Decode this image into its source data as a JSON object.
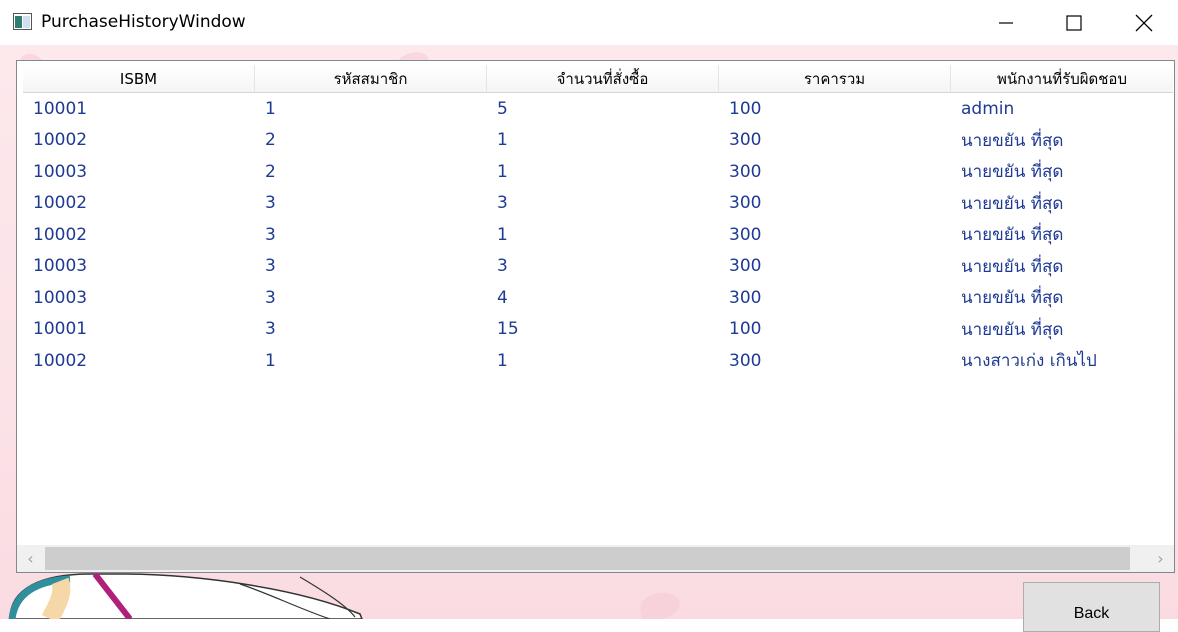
{
  "window": {
    "title": "PurchaseHistoryWindow",
    "app_icon": "window-app-icon"
  },
  "controls": {
    "minimize": "minimize-icon",
    "maximize": "maximize-icon",
    "close": "close-icon"
  },
  "grid": {
    "columns": [
      "ISBM",
      "รหัสสมาชิก",
      "จำนวนที่สั่งซื้อ",
      "ราคารวม",
      "พนักงานที่รับผิดชอบ"
    ],
    "rows": [
      [
        "10001",
        "1",
        "5",
        "100",
        "admin"
      ],
      [
        "10002",
        "2",
        "1",
        "300",
        "นายขยัน ที่สุด"
      ],
      [
        "10003",
        "2",
        "1",
        "300",
        "นายขยัน ที่สุด"
      ],
      [
        "10002",
        "3",
        "3",
        "300",
        "นายขยัน ที่สุด"
      ],
      [
        "10002",
        "3",
        "1",
        "300",
        "นายขยัน ที่สุด"
      ],
      [
        "10003",
        "3",
        "3",
        "300",
        "นายขยัน ที่สุด"
      ],
      [
        "10003",
        "3",
        "4",
        "300",
        "นายขยัน ที่สุด"
      ],
      [
        "10001",
        "3",
        "15",
        "100",
        "นายขยัน ที่สุด"
      ],
      [
        "10002",
        "1",
        "1",
        "300",
        "นางสาวเก่ง เกินไป"
      ]
    ],
    "text_color": "#1f3a93"
  },
  "scrollbar": {
    "left_arrow": "‹",
    "right_arrow": "›"
  },
  "back_button": {
    "label": "Back"
  }
}
